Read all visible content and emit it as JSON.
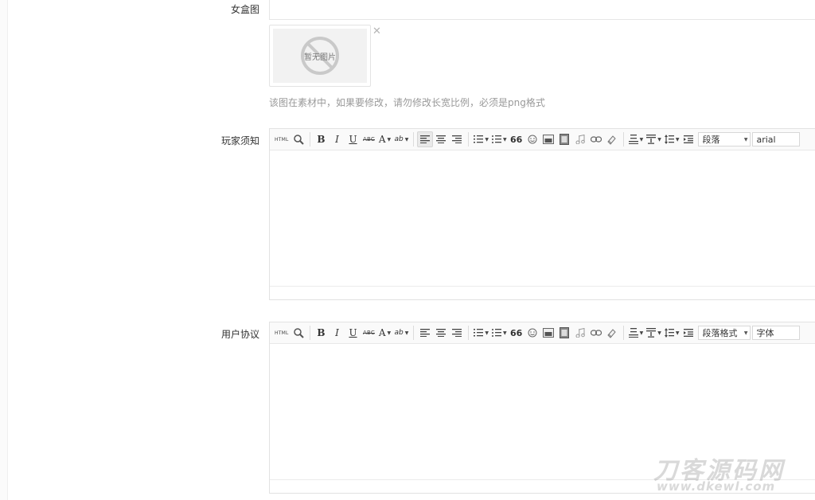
{
  "form": {
    "girl_box_label": "女盒图",
    "image_placeholder_text": "暂无图片",
    "close_glyph": "✕",
    "image_hint": "该图在素材中，如果要修改，请勿修改长宽比例，必须是png格式",
    "rules_label": "玩家须知",
    "agreement_label": "用户协议"
  },
  "editor_one": {
    "paragraph_select": "段落",
    "font_select": "arial"
  },
  "editor_two": {
    "paragraph_select": "段落格式",
    "font_select": "字体"
  },
  "toolbar": {
    "html": "HTML",
    "bold": "B",
    "italic": "I",
    "underline": "U",
    "strike": "ABC",
    "font_color": "A",
    "highlight": "ab",
    "quote": "66"
  },
  "watermark": {
    "title": "刀客源码网",
    "url": "www.dkewl.com"
  },
  "colors": {
    "border": "#e2e2e2",
    "hint": "#999999",
    "toolbar_bg": "#fafafa"
  }
}
